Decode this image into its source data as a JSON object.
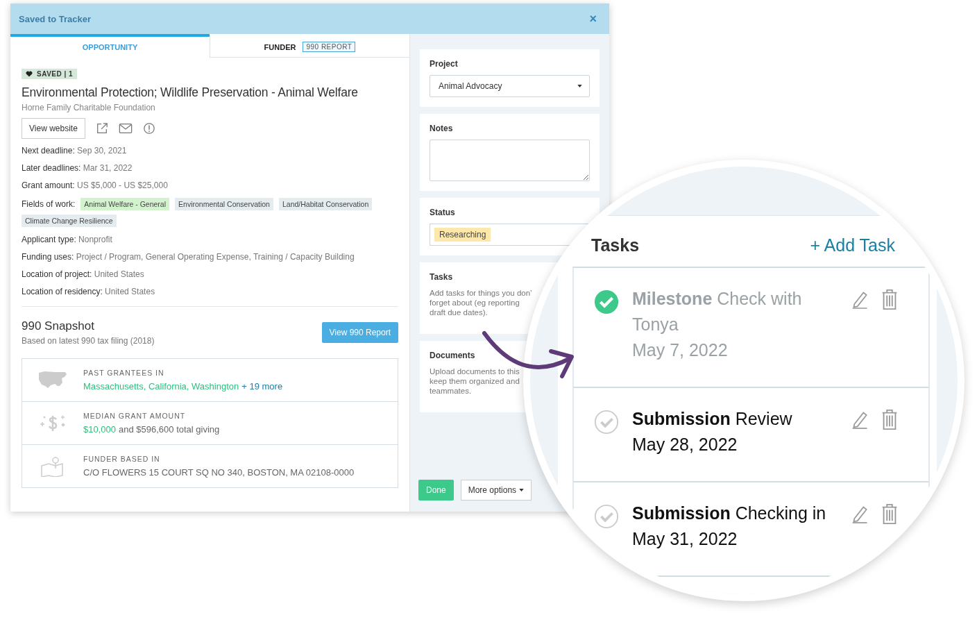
{
  "window": {
    "title": "Saved to Tracker",
    "close": "×"
  },
  "tabs": [
    {
      "label": "OPPORTUNITY",
      "selected": true
    },
    {
      "label": "FUNDER",
      "badge": "990 REPORT",
      "selected": false
    }
  ],
  "saved_badge": "SAVED | 1",
  "title": "Environmental Protection; Wildlife Preservation - Animal Welfare",
  "funder": "Horne Family Charitable Foundation",
  "view_website": "View website",
  "details": [
    {
      "label": "Next deadline:",
      "value": "Sep 30, 2021"
    },
    {
      "label": "Later deadlines:",
      "value": "Mar 31, 2022"
    },
    {
      "label": "Grant amount:",
      "value": "US $5,000 - US $25,000"
    }
  ],
  "fields_of_work": {
    "label": "Fields of work:",
    "tags": [
      {
        "text": "Animal Welfare - General",
        "color": "#d3f3cf"
      },
      {
        "text": "Environmental Conservation",
        "color": "#e4ecef"
      },
      {
        "text": "Land/Habitat Conservation",
        "color": "#e4ecef"
      },
      {
        "text": "Climate Change Resilience",
        "color": "#e4ecef"
      }
    ]
  },
  "details_2": [
    {
      "label": "Applicant type:",
      "value": "Nonprofit"
    },
    {
      "label": "Funding uses:",
      "value": "Project / Program, General Operating Expense, Training / Capacity Building"
    },
    {
      "label": "Location of project:",
      "value": "United States"
    },
    {
      "label": "Location of residency:",
      "value": "United States"
    }
  ],
  "snapshot": {
    "title": "990 Snapshot",
    "subtitle": "Based on latest 990 tax filing (2018)",
    "button": "View 990 Report",
    "rows": [
      {
        "kind": "map",
        "label": "PAST GRANTEES IN",
        "highlight": "Massachusetts, California, Washington",
        "link": "+ 19 more"
      },
      {
        "kind": "money",
        "label": "MEDIAN GRANT AMOUNT",
        "highlight": "$10,000",
        "rest": "and $596,600 total giving"
      },
      {
        "kind": "pin",
        "label": "FUNDER BASED IN",
        "rest": "C/O FLOWERS 15 COURT SQ NO 340, BOSTON, MA 02108-0000"
      }
    ]
  },
  "side": {
    "project": {
      "label": "Project",
      "value": "Animal Advocacy"
    },
    "notes": {
      "label": "Notes"
    },
    "status": {
      "label": "Status",
      "value": "Researching"
    },
    "tasks": {
      "label": "Tasks",
      "lines": [
        "Add tasks for things you don’",
        "forget about (eg reporting",
        "draft due dates)."
      ]
    },
    "documents": {
      "label": "Documents",
      "lines": [
        "Upload documents to this",
        "keep them organized and",
        "teammates."
      ]
    },
    "buttons": [
      {
        "label": "Done",
        "kind": "primary"
      },
      {
        "label": "More options",
        "kind": "dropdown"
      }
    ]
  },
  "magnifier": {
    "title": "Tasks",
    "add": "+ Add Task",
    "tasks": [
      {
        "title": "**Milestone** Check with Tonya",
        "date": "May 7, 2022",
        "done": true
      },
      {
        "title": "**Submission** Review",
        "date": "May 28, 2022",
        "done": false
      },
      {
        "title": "**Submission** Checking in",
        "date": "May 31, 2022",
        "done": false
      }
    ]
  }
}
